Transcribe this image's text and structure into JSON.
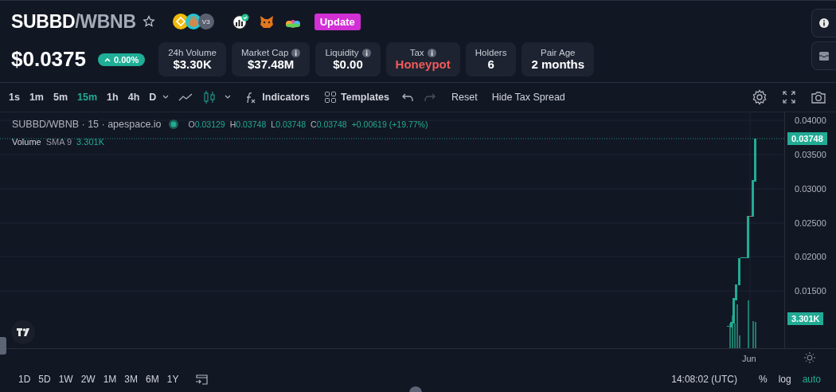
{
  "pair": {
    "base": "SUBBD",
    "quote": "/WBNB",
    "favorite": false
  },
  "dex_badge": "V3",
  "update_button": "Update",
  "price": "$0.0375",
  "price_change": "0.00%",
  "stats": [
    {
      "label": "24h Volume",
      "value": "$3.30K",
      "info": false,
      "kind": "normal"
    },
    {
      "label": "Market Cap",
      "value": "$37.48M",
      "info": true,
      "kind": "normal"
    },
    {
      "label": "Liquidity",
      "value": "$0.00",
      "info": true,
      "kind": "normal"
    },
    {
      "label": "Tax",
      "value": "Honeypot",
      "info": true,
      "kind": "alert"
    },
    {
      "label": "Holders",
      "value": "6",
      "info": false,
      "kind": "normal"
    },
    {
      "label": "Pair Age",
      "value": "2 months",
      "info": false,
      "kind": "normal"
    }
  ],
  "timeframes": [
    {
      "label": "1s",
      "selected": false
    },
    {
      "label": "1m",
      "selected": false
    },
    {
      "label": "5m",
      "selected": false
    },
    {
      "label": "15m",
      "selected": true
    },
    {
      "label": "1h",
      "selected": false
    },
    {
      "label": "4h",
      "selected": false
    },
    {
      "label": "D",
      "selected": false
    }
  ],
  "toolbar": {
    "indicators": "Indicators",
    "templates": "Templates",
    "reset": "Reset",
    "hide_tax_spread": "Hide Tax Spread"
  },
  "legend": {
    "symbol": "SUBBD/WBNB · 15 · apespace.io",
    "ohlc": [
      {
        "key": "O",
        "value": "0.03129"
      },
      {
        "key": "H",
        "value": "0.03748"
      },
      {
        "key": "L",
        "value": "0.03748"
      },
      {
        "key": "C",
        "value": "0.03748"
      }
    ],
    "change": "+0.00619 (+19.77%)"
  },
  "volume_legend": {
    "name": "Volume",
    "params": "SMA 9",
    "value": "3.301K"
  },
  "price_axis": [
    "0.04000",
    "0.03500",
    "0.03000",
    "0.02500",
    "0.02000",
    "0.01500"
  ],
  "last_price": "0.03748",
  "volume_badge": "3.301K",
  "time_axis": [
    "Jun"
  ],
  "ranges": [
    "1D",
    "5D",
    "1W",
    "2W",
    "1M",
    "3M",
    "6M",
    "1Y"
  ],
  "clock": "14:08:02 (UTC)",
  "scale_buttons": [
    {
      "label": "%",
      "selected": false
    },
    {
      "label": "log",
      "selected": false
    },
    {
      "label": "auto",
      "selected": true
    }
  ]
}
